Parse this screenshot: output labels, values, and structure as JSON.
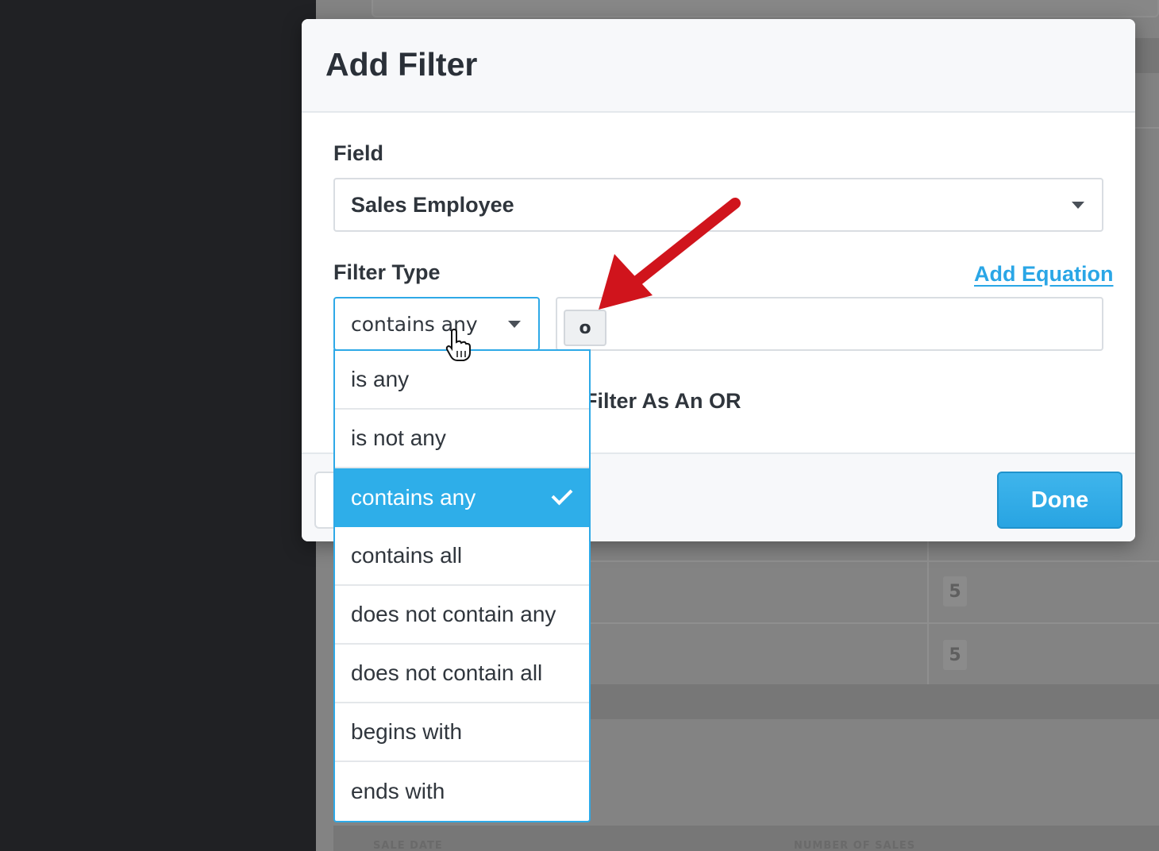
{
  "modal": {
    "title": "Add Filter",
    "field_label": "Field",
    "field_value": "Sales Employee",
    "filter_type_label": "Filter Type",
    "filter_type_value": "contains any",
    "add_equation_link": "Add Equation",
    "token_value": "o",
    "or_toggle_label_partial": "Filter As An OR",
    "done_button": "Done"
  },
  "dropdown": {
    "options": [
      "is any",
      "is not any",
      "contains any",
      "contains all",
      "does not contain any",
      "does not contain all",
      "begins with",
      "ends with"
    ],
    "selected": "contains any"
  },
  "background": {
    "cell_values": [
      "5",
      "5"
    ],
    "footer_headers": [
      "SALE DATE",
      "NUMBER OF SALES"
    ]
  },
  "colors": {
    "accent": "#2eaee9",
    "annotation_arrow": "#d0141c",
    "sidebar": "#202124"
  },
  "icons": {
    "field_caret": "chevron-down-icon",
    "filter_caret": "chevron-down-icon",
    "selected_check": "check-icon",
    "cursor": "hand-pointer-icon",
    "annotation": "red-arrow-icon"
  }
}
